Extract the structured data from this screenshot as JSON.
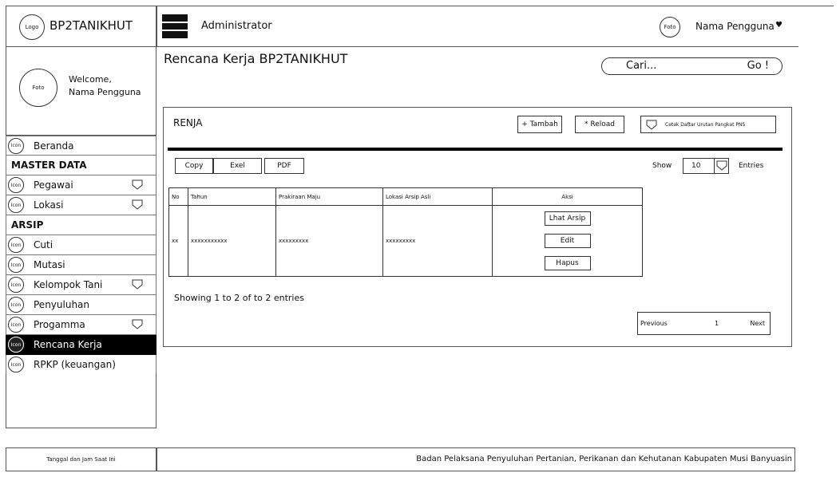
{
  "sidebar": {
    "logo_label": "Logo",
    "brand": "BP2TANIKHUT",
    "profile": {
      "foto_label": "Foto",
      "welcome": "Welcome,",
      "user_name": "Nama Pengguna"
    },
    "icon_label": "Icon",
    "items": [
      {
        "label": "Beranda",
        "dropdown": false,
        "active": false
      },
      {
        "label": "Pegawai",
        "dropdown": true,
        "active": false
      },
      {
        "label": "Lokasi",
        "dropdown": true,
        "active": false
      },
      {
        "label": "Cuti",
        "dropdown": false,
        "active": false
      },
      {
        "label": "Mutasi",
        "dropdown": false,
        "active": false
      },
      {
        "label": "Kelompok Tani",
        "dropdown": true,
        "active": false
      },
      {
        "label": "Penyuluhan",
        "dropdown": false,
        "active": false
      },
      {
        "label": "Progamma",
        "dropdown": true,
        "active": false
      },
      {
        "label": "Rencana Kerja",
        "dropdown": false,
        "active": true
      },
      {
        "label": "RPKP (keuangan)",
        "dropdown": false,
        "active": false
      }
    ],
    "section_master": "MASTER DATA",
    "section_arsip": "ARSIP",
    "datetime": "Tanggal dan Jam Saat Ini"
  },
  "header": {
    "role": "Administrator",
    "foto_label": "Foto",
    "user_name": "Nama Pengguna",
    "user_menu_glyph": "♥"
  },
  "main": {
    "page_title": "Rencana Kerja BP2TANIKHUT",
    "search_placeholder": "Cari...",
    "search_go": "Go !",
    "panel_title": "RENJA",
    "add_label": "+ Tambah",
    "reload_label": "* Reload",
    "print_label": "Cetak Daftar Urutan Pangkat PNS",
    "export": {
      "copy": "Copy",
      "excel": "Exel",
      "pdf": "PDF"
    },
    "show_label": "Show",
    "entries_value": "10",
    "entries_label": "Entries",
    "table": {
      "columns": [
        "No",
        "Tahun",
        "Prakiraan Maju",
        "Lokasi Arsip Asli",
        "Aksi"
      ],
      "rows": [
        {
          "no": "xx",
          "tahun": "xxxxxxxxxxx",
          "prakiraan": "xxxxxxxxx",
          "lokasi": "xxxxxxxxx"
        }
      ],
      "actions": {
        "view": "Lhat Arsip",
        "edit": "Edit",
        "delete": "Hapus"
      }
    },
    "showing": "Showing 1 to 2 of to 2 entries",
    "pagination": {
      "previous": "Previous",
      "page": "1",
      "next": "Next"
    }
  },
  "footer": {
    "org": "Badan Pelaksana Penyuluhan Pertanian, Perikanan dan Kehutanan Kabupaten Musi Banyuasin"
  }
}
